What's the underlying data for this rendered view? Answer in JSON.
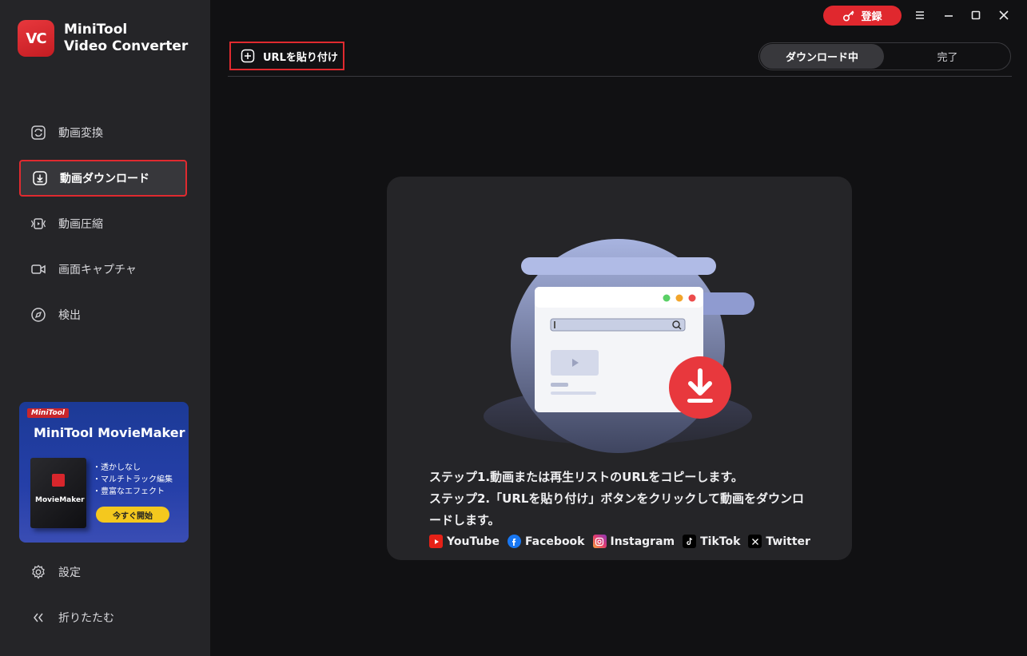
{
  "app": {
    "logo_mark": "VC",
    "name_line1": "MiniTool",
    "name_line2": "Video Converter"
  },
  "sidebar": {
    "items": [
      {
        "label": "動画変換"
      },
      {
        "label": "動画ダウンロード"
      },
      {
        "label": "動画圧縮"
      },
      {
        "label": "画面キャプチャ"
      },
      {
        "label": "検出"
      }
    ],
    "promo": {
      "brand": "MiniTool",
      "title": "MiniTool MovieMaker",
      "box_label": "MovieMaker",
      "features": [
        "・透かしなし",
        "・マルチトラック編集",
        "・豊富なエフェクト"
      ],
      "button": "今すぐ開始"
    },
    "settings_label": "設定",
    "collapse_label": "折りたたむ"
  },
  "titlebar": {
    "register_label": "登録"
  },
  "toolbar": {
    "paste_label": "URLを貼り付け",
    "tabs": [
      {
        "label": "ダウンロード中"
      },
      {
        "label": "完了"
      }
    ]
  },
  "main": {
    "step1": "ステップ1.動画または再生リストのURLをコピーします。",
    "step2": "ステップ2.「URLを貼り付け」ボタンをクリックして動画をダウンロードします。",
    "platforms": [
      {
        "label": "YouTube"
      },
      {
        "label": "Facebook"
      },
      {
        "label": "Instagram"
      },
      {
        "label": "TikTok"
      },
      {
        "label": "Twitter"
      }
    ]
  },
  "colors": {
    "accent_red": "#e0282e",
    "sidebar_bg": "#252528",
    "main_bg": "#111113",
    "promo_button": "#f4c81e"
  }
}
